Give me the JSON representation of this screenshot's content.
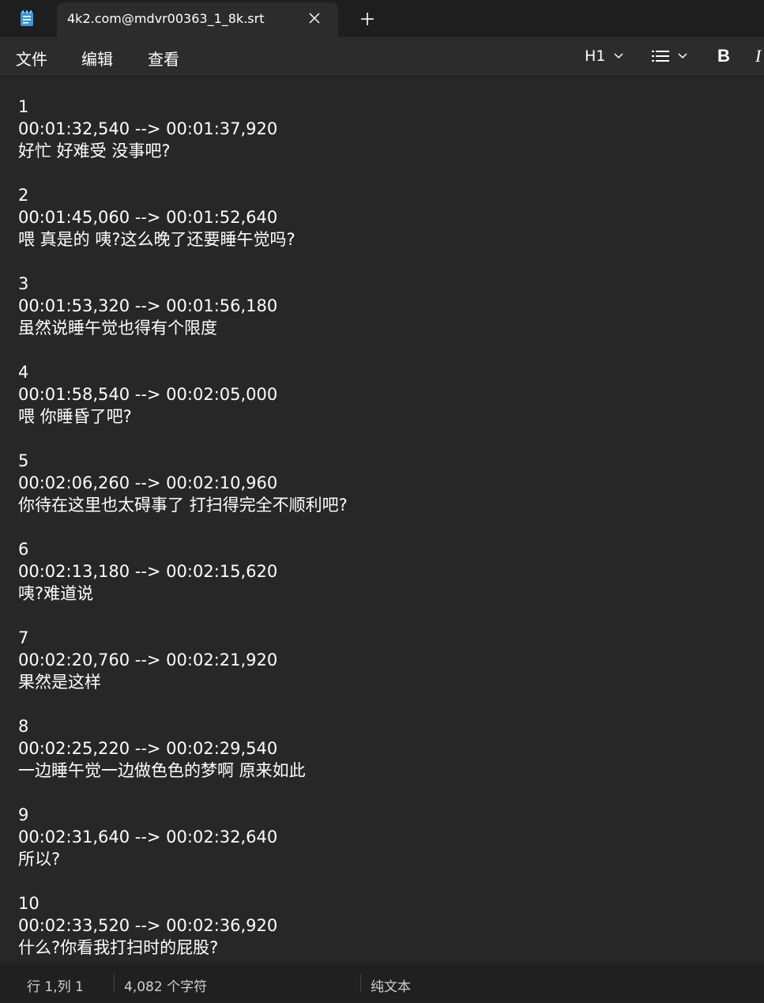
{
  "window": {
    "tab_title": "4k2.com@mdvr00363_1_8k.srt",
    "icons": {
      "app": "notepad-icon",
      "close": "close-icon",
      "new_tab": "plus-icon"
    }
  },
  "menu": {
    "file": "文件",
    "edit": "编辑",
    "view": "查看"
  },
  "toolbar": {
    "heading": "H1",
    "bold": "B",
    "italic": "I",
    "icons": {
      "heading_chevron": "chevron-down-icon",
      "list": "list-icon",
      "list_chevron": "chevron-down-icon"
    }
  },
  "editor": {
    "entries": [
      {
        "index": "1",
        "time": "00:01:32,540 --> 00:01:37,920",
        "text": "好忙 好难受 没事吧?"
      },
      {
        "index": "2",
        "time": "00:01:45,060 --> 00:01:52,640",
        "text": "喂 真是的 咦?这么晚了还要睡午觉吗?"
      },
      {
        "index": "3",
        "time": "00:01:53,320 --> 00:01:56,180",
        "text": "虽然说睡午觉也得有个限度"
      },
      {
        "index": "4",
        "time": "00:01:58,540 --> 00:02:05,000",
        "text": "喂 你睡昏了吧?"
      },
      {
        "index": "5",
        "time": "00:02:06,260 --> 00:02:10,960",
        "text": "你待在这里也太碍事了 打扫得完全不顺利吧?"
      },
      {
        "index": "6",
        "time": "00:02:13,180 --> 00:02:15,620",
        "text": "咦?难道说"
      },
      {
        "index": "7",
        "time": "00:02:20,760 --> 00:02:21,920",
        "text": "果然是这样"
      },
      {
        "index": "8",
        "time": "00:02:25,220 --> 00:02:29,540",
        "text": "一边睡午觉一边做色色的梦啊 原来如此"
      },
      {
        "index": "9",
        "time": "00:02:31,640 --> 00:02:32,640",
        "text": "所以?"
      },
      {
        "index": "10",
        "time": "00:02:33,520 --> 00:02:36,920",
        "text": "什么?你看我打扫时的屁股?"
      }
    ]
  },
  "status": {
    "position": "行 1,列 1",
    "char_count": "4,082 个字符",
    "format": "纯文本"
  },
  "colors": {
    "background": "#272727",
    "tabbar": "#1e1e1e",
    "menubar": "#2c2c2c",
    "statusbar": "#202020",
    "text": "#ffffff",
    "icon_blue": "#3a96dd"
  }
}
